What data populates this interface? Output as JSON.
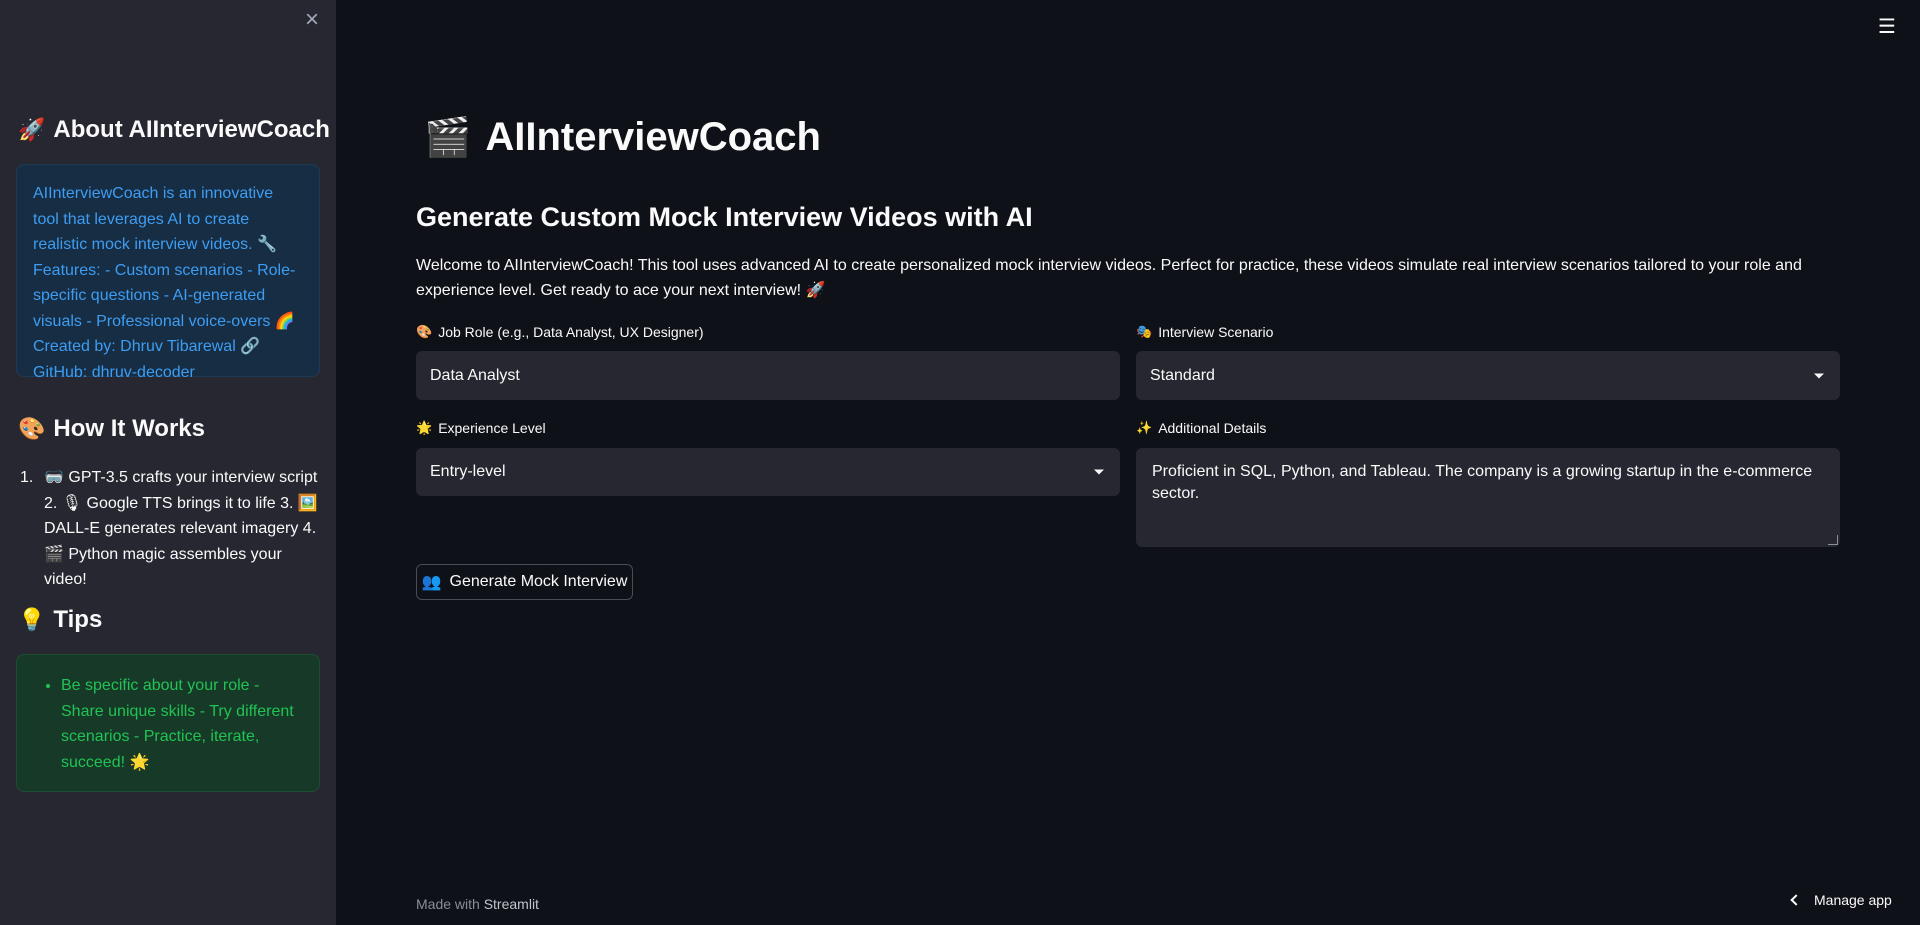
{
  "sidebar": {
    "close_icon": "×",
    "about": {
      "emoji": "🚀",
      "heading": "About AIInterviewCoach",
      "text": "AIInterviewCoach is an innovative tool that leverages AI to create realistic mock interview videos. 🔧 Features: - Custom scenarios - Role-specific questions - AI-generated visuals - Professional voice-overs 🌈 Created by: Dhruv Tibarewal 🔗 GitHub: dhruv-decoder"
    },
    "how": {
      "emoji": "🎨",
      "heading": "How It Works",
      "number": "1.",
      "text": "🥽 GPT-3.5 crafts your interview script 2. 🎙 Google TTS brings it to life 3. 🖼️ DALL-E generates relevant imagery 4. 🎬 Python magic assembles your video!"
    },
    "tips": {
      "emoji": "💡",
      "heading": "Tips",
      "text": "Be specific about your role - Share unique skills - Try different scenarios - Practice, iterate, succeed! 🌟"
    }
  },
  "main": {
    "title_emoji": "🎬",
    "title": "AIInterviewCoach",
    "subtitle": "Generate Custom Mock Interview Videos with AI",
    "welcome": "Welcome to AIInterviewCoach! This tool uses advanced AI to create personalized mock interview videos. Perfect for practice, these videos simulate real interview scenarios tailored to your role and experience level. Get ready to ace your next interview! 🚀",
    "job_role": {
      "emoji": "🎨",
      "label": "Job Role (e.g., Data Analyst, UX Designer)",
      "value": "Data Analyst"
    },
    "scenario": {
      "emoji": "🎭",
      "label": "Interview Scenario",
      "value": "Standard"
    },
    "experience": {
      "emoji": "🌟",
      "label": "Experience Level",
      "value": "Entry-level"
    },
    "details": {
      "emoji": "✨",
      "label": "Additional Details",
      "value": "Proficient in SQL, Python, and Tableau. The company is a growing startup in the e-commerce sector."
    },
    "generate_button": {
      "emoji": "👥",
      "label": "Generate Mock Interview"
    }
  },
  "footer": {
    "prefix": "Made with",
    "brand": "Streamlit"
  },
  "manage_app": "Manage app",
  "menu_icon": "☰"
}
